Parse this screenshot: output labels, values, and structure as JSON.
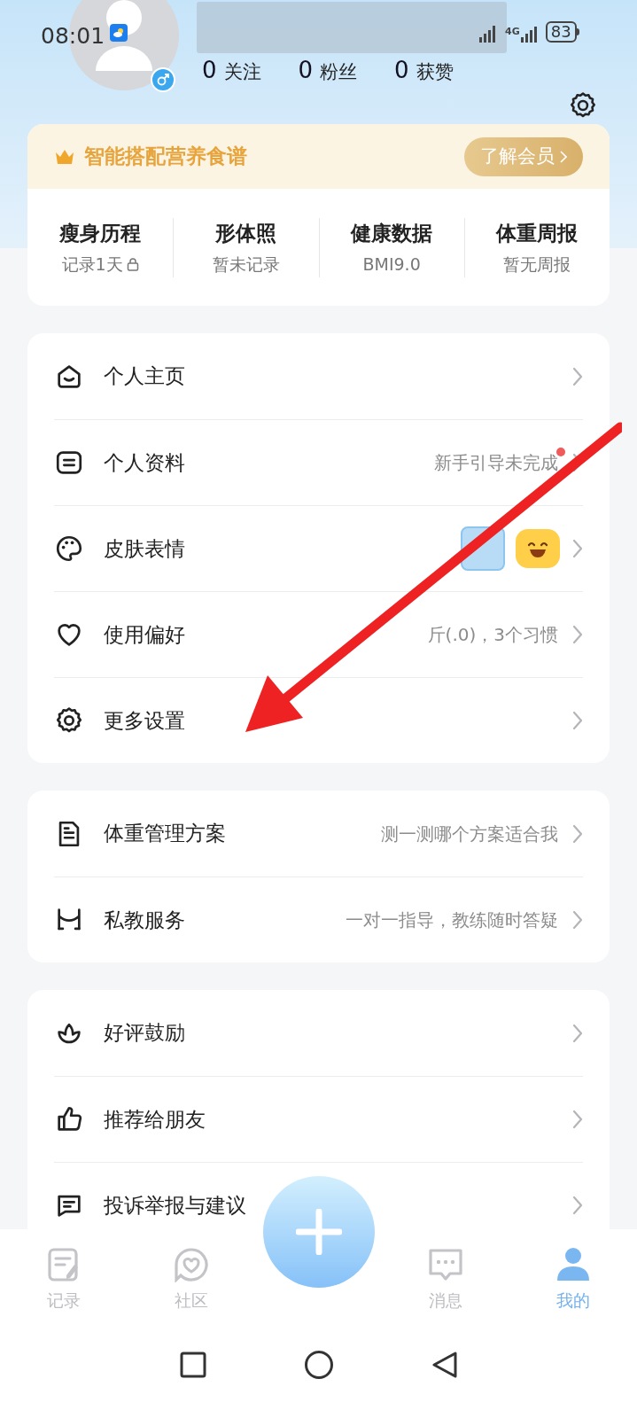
{
  "status_bar": {
    "time": "08:01",
    "network": "4G",
    "battery": "83"
  },
  "profile": {
    "stats": [
      {
        "value": "0",
        "label": "关注"
      },
      {
        "value": "0",
        "label": "粉丝"
      },
      {
        "value": "0",
        "label": "获赞"
      }
    ]
  },
  "vip_banner": {
    "title": "智能搭配营养食谱",
    "button": "了解会员"
  },
  "highlights": [
    {
      "title": "瘦身历程",
      "subtitle": "记录1天",
      "locked": true
    },
    {
      "title": "形体照",
      "subtitle": "暂未记录",
      "locked": false
    },
    {
      "title": "健康数据",
      "subtitle": "BMI9.0",
      "locked": false
    },
    {
      "title": "体重周报",
      "subtitle": "暂无周报",
      "locked": false
    }
  ],
  "menu_groups": [
    [
      {
        "label": "个人主页",
        "kind": "plain"
      },
      {
        "label": "个人资料",
        "kind": "plain",
        "value": "新手引导未完成",
        "badge": true
      },
      {
        "label": "皮肤表情",
        "kind": "skins"
      },
      {
        "label": "使用偏好",
        "kind": "plain",
        "value": "斤(.0)，3个习惯"
      },
      {
        "label": "更多设置",
        "kind": "plain"
      }
    ],
    [
      {
        "label": "体重管理方案",
        "kind": "plain",
        "value": "测一测哪个方案适合我"
      },
      {
        "label": "私教服务",
        "kind": "plain",
        "value": "一对一指导，教练随时答疑"
      }
    ],
    [
      {
        "label": "好评鼓励",
        "kind": "plain"
      },
      {
        "label": "推荐给朋友",
        "kind": "plain"
      },
      {
        "label": "投诉举报与建议",
        "kind": "plain"
      }
    ]
  ],
  "tab_bar": [
    {
      "label": "记录",
      "selected": false
    },
    {
      "label": "社区",
      "selected": false
    },
    {
      "label": "消息",
      "selected": false
    },
    {
      "label": "我的",
      "selected": true
    }
  ]
}
